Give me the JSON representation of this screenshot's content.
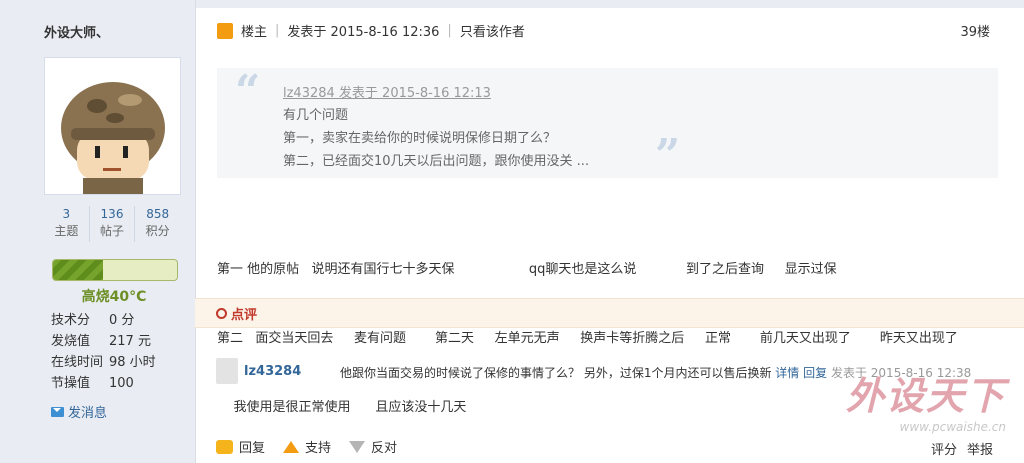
{
  "user": {
    "name": "外设大师、",
    "stats": [
      {
        "value": "3",
        "label": "主题"
      },
      {
        "value": "136",
        "label": "帖子"
      },
      {
        "value": "858",
        "label": "积分"
      }
    ],
    "heat": {
      "level": 0.4,
      "text": "高烧40°C"
    },
    "info": [
      {
        "key": "技术分",
        "value": "0 分"
      },
      {
        "key": "发烧值",
        "value": "217 元"
      },
      {
        "key": "在线时间",
        "value": "98 小时"
      },
      {
        "key": "节操值",
        "value": "100"
      }
    ],
    "pm_label": "发消息"
  },
  "post": {
    "role": "楼主",
    "posted_at": "发表于 2015-8-16 12:36",
    "only_author": "只看该作者",
    "floor": "39楼",
    "quote": {
      "header": "lz43284 发表于 2015-8-16 12:13",
      "lines": [
        "有几个问题",
        "第一，卖家在卖给你的时候说明保修日期了么？",
        "第二，已经面交10几天以后出问题，跟你使用没关 ..."
      ]
    },
    "body_lines": [
      "第一 他的原帖   说明还有国行七十多天保                  qq聊天也是这么说            到了之后查询     显示过保",
      "第二   面交当天回去     麦有问题       第二天     左单元无声     换声卡等折腾之后     正常       前几天又出现了       昨天又出现了",
      "    我使用是很正常使用      且应该没十几天"
    ]
  },
  "dianping": {
    "label": "点评",
    "comment": {
      "user": "lz43284",
      "text": "他跟你当面交易的时候说了保修的事情了么？ 另外，过保1个月内还可以售后换新",
      "detail": "详情",
      "reply": "回复",
      "time": "发表于 2015-8-16 12:38"
    }
  },
  "watermark": {
    "title": "外设天下",
    "url": "www.pcwaishe.cn"
  },
  "actions": {
    "reply": "回复",
    "support": "支持",
    "oppose": "反对",
    "rate": "评分",
    "report": "举报"
  }
}
